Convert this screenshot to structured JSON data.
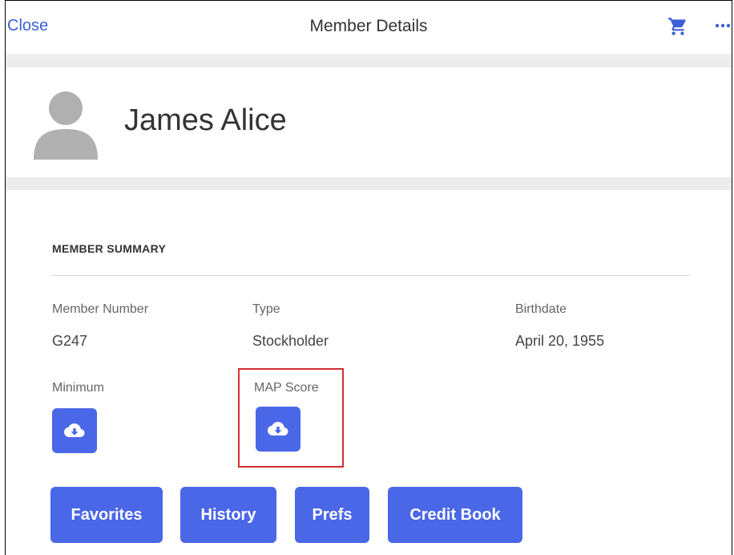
{
  "header": {
    "close_label": "Close",
    "title": "Member Details",
    "cart_icon": "shopping-cart-icon",
    "more_icon": "more-horizontal-icon",
    "accent_color": "#3d5fd6"
  },
  "profile": {
    "name": "James Alice",
    "avatar_icon": "user-avatar-icon"
  },
  "summary": {
    "title": "MEMBER SUMMARY",
    "fields": [
      {
        "label": "Member Number",
        "value": "G247"
      },
      {
        "label": "Type",
        "value": "Stockholder"
      },
      {
        "label": "Birthdate",
        "value": "April 20, 1955"
      }
    ],
    "downloads": [
      {
        "label": "Minimum",
        "icon": "cloud-download-icon"
      },
      {
        "label": "MAP Score",
        "icon": "cloud-download-icon",
        "highlighted": true
      }
    ]
  },
  "actions": [
    "Favorites",
    "History",
    "Prefs",
    "Credit Book"
  ],
  "colors": {
    "button": "#4a67e8",
    "highlight_border": "#d32f2f",
    "band": "#ececec"
  }
}
